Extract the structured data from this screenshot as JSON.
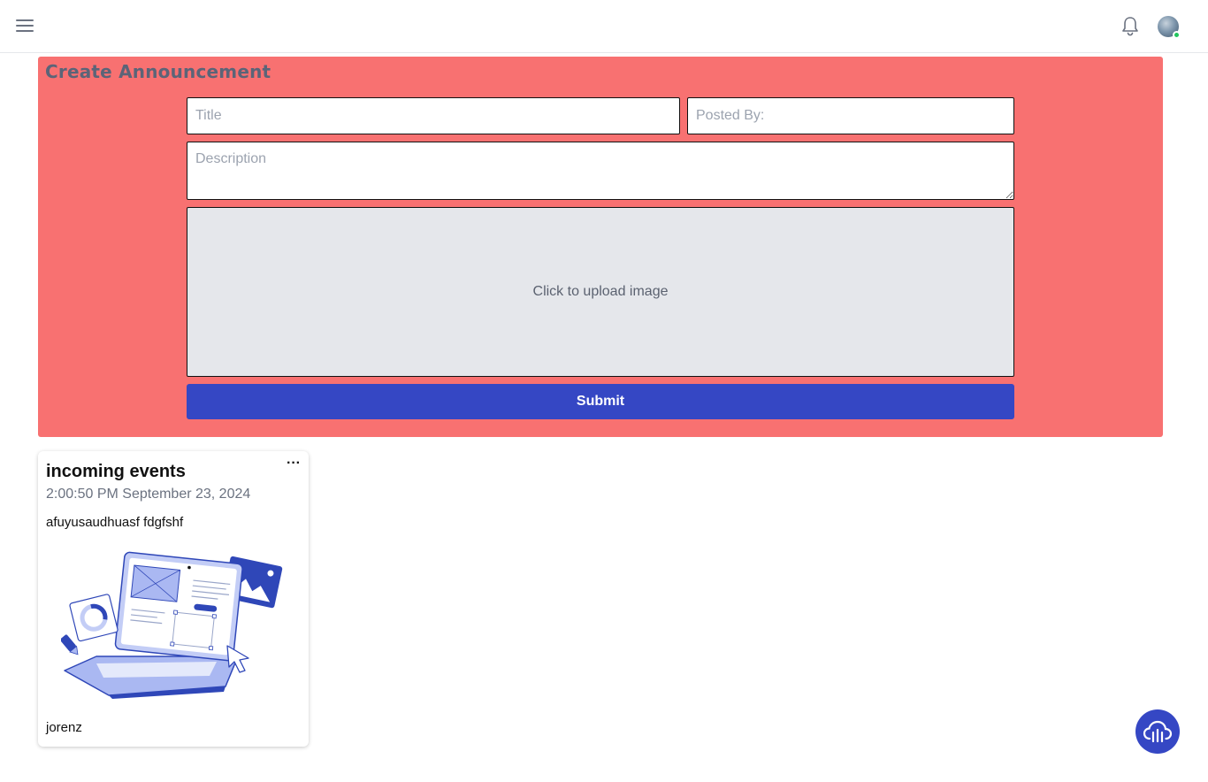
{
  "topbar": {
    "menu_icon": "hamburger-menu-icon",
    "notification_icon": "bell-icon",
    "avatar_icon": "user-avatar",
    "status_color": "#22c55e"
  },
  "form": {
    "heading": "Create Announcement",
    "title_placeholder": "Title",
    "posted_by_placeholder": "Posted By:",
    "description_placeholder": "Description",
    "upload_label": "Click to upload image",
    "submit_label": "Submit",
    "background_color": "#f87171",
    "accent_color": "#3547c4"
  },
  "announcements": [
    {
      "title": "incoming events",
      "timestamp": "2:00:50 PM September 23, 2024",
      "description": "afuyusaudhuasf fdgfshf",
      "author": "jorenz",
      "menu_label": "···",
      "image_icon": "laptop-design-illustration"
    }
  ],
  "fab": {
    "icon": "cloud-upload-icon"
  }
}
